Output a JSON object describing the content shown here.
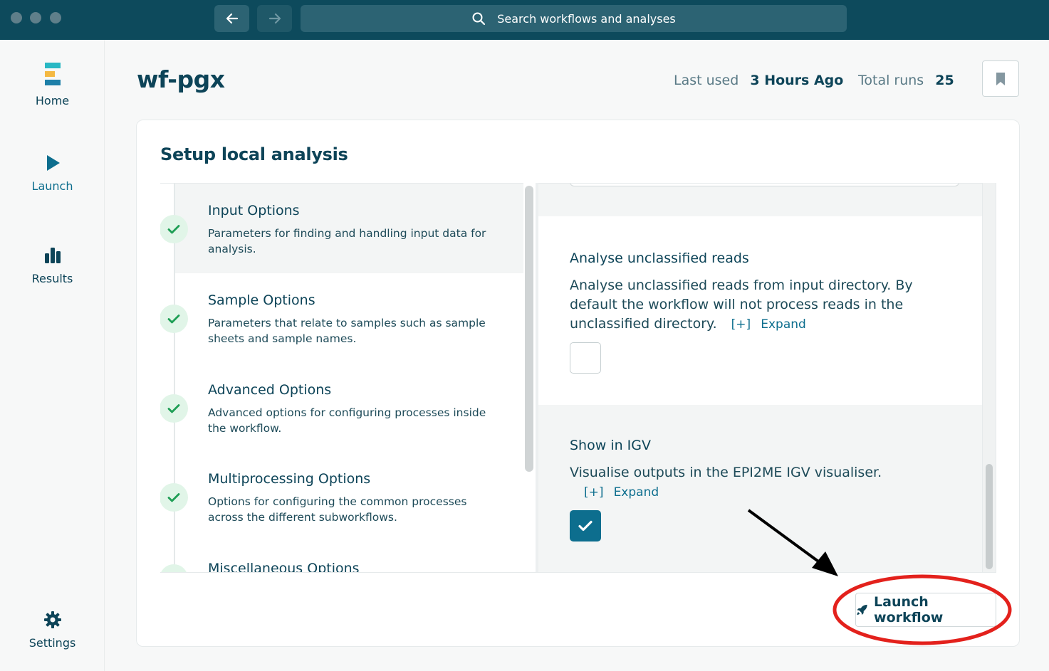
{
  "titlebar": {
    "search_placeholder": "Search workflows and analyses",
    "back_icon": "arrow-left-icon",
    "forward_icon": "arrow-right-icon"
  },
  "sidebar": {
    "items": [
      {
        "label": "Home",
        "icon": "logo-icon"
      },
      {
        "label": "Launch",
        "icon": "play-icon"
      },
      {
        "label": "Results",
        "icon": "bar-chart-icon"
      },
      {
        "label": "Settings",
        "icon": "gear-icon"
      }
    ]
  },
  "header": {
    "title": "wf-pgx",
    "last_used_label": "Last used",
    "last_used_value": "3 Hours Ago",
    "total_runs_label": "Total runs",
    "total_runs_value": "25"
  },
  "card": {
    "title": "Setup local analysis",
    "sections": [
      {
        "title": "Input Options",
        "description": "Parameters for finding and handling input data for analysis.",
        "complete": true
      },
      {
        "title": "Sample Options",
        "description": "Parameters that relate to samples such as sample sheets and sample names.",
        "complete": true
      },
      {
        "title": "Advanced Options",
        "description": "Advanced options for configuring processes inside the workflow.",
        "complete": true
      },
      {
        "title": "Multiprocessing Options",
        "description": "Options for configuring the common processes across the different subworkflows.",
        "complete": true
      },
      {
        "title": "Miscellaneous Options",
        "description": "",
        "complete": true
      }
    ],
    "fields": [
      {
        "title": "Analyse unclassified reads",
        "description": "Analyse unclassified reads from input directory. By default the workflow will not process reads in the unclassified directory.",
        "expand_bracket": "[+]",
        "expand_label": "Expand",
        "checked": false
      },
      {
        "title": "Show in IGV",
        "description": "Visualise outputs in the EPI2ME IGV visualiser.",
        "expand_bracket": "[+]",
        "expand_label": "Expand",
        "checked": true
      }
    ],
    "launch_label": "Launch workflow"
  },
  "colors": {
    "titlebar": "#0d4a5c",
    "accent": "#0d6e8e",
    "success_bg": "#e1f5e8",
    "success": "#1e9e55",
    "annotation_red": "#e3211c"
  }
}
